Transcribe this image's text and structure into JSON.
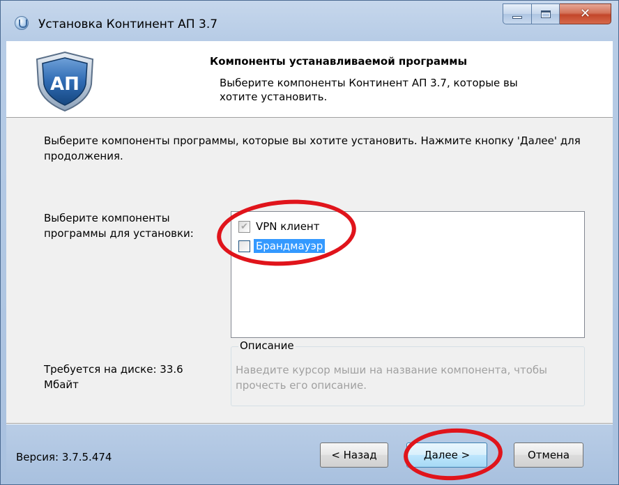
{
  "window": {
    "title": "Установка Континент АП 3.7"
  },
  "header": {
    "logo_text": "АП",
    "title": "Компоненты устанавливаемой программы",
    "description": "Выберите компоненты Континент АП 3.7, которые вы хотите установить."
  },
  "intro_text": "Выберите компоненты программы, которые вы хотите установить. Нажмите кнопку 'Далее' для продолжения.",
  "components": {
    "label": "Выберите компоненты программы для установки:",
    "items": [
      {
        "label": "VPN клиент",
        "checked": true,
        "disabled": true,
        "selected": false
      },
      {
        "label": "Брандмауэр",
        "checked": false,
        "disabled": false,
        "selected": true
      }
    ]
  },
  "description_group": {
    "legend": "Описание",
    "placeholder": "Наведите курсор мыши на название компонента, чтобы прочесть его описание."
  },
  "disk_space": "Требуется на диске: 33.6 Мбайт",
  "footer": {
    "version": "Версия: 3.7.5.474",
    "back_label": "< Назад",
    "next_label": "Далее >",
    "cancel_label": "Отмена"
  },
  "colors": {
    "selection": "#3399ff",
    "annotation": "#e0141b",
    "frame": "#a9c1df"
  },
  "icons": {
    "app": "shield-app-icon",
    "header": "shield-ap-logo-icon",
    "check": "checkmark-icon"
  }
}
